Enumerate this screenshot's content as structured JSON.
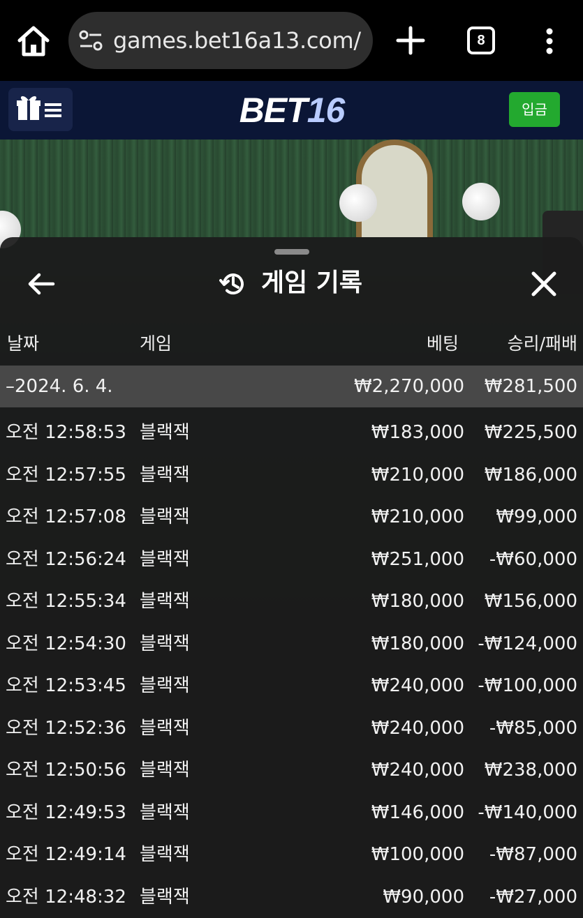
{
  "browser": {
    "url": "games.bet16a13.com/",
    "tab_count": "8"
  },
  "header": {
    "logo_part1": "BET",
    "logo_part2": "16",
    "deposit_label": "입금"
  },
  "panel": {
    "title": "게임 기록",
    "columns": {
      "date": "날짜",
      "game": "게임",
      "bet": "베팅",
      "result": "승리/패배"
    },
    "summary": {
      "date": "–2024. 6. 4.",
      "bet": "₩2,270,000",
      "result": "₩281,500"
    },
    "rows": [
      {
        "time": "오전 12:58:53",
        "game": "블랙잭",
        "bet": "₩183,000",
        "result": "₩225,500"
      },
      {
        "time": "오전 12:57:55",
        "game": "블랙잭",
        "bet": "₩210,000",
        "result": "₩186,000"
      },
      {
        "time": "오전 12:57:08",
        "game": "블랙잭",
        "bet": "₩210,000",
        "result": "₩99,000"
      },
      {
        "time": "오전 12:56:24",
        "game": "블랙잭",
        "bet": "₩251,000",
        "result": "-₩60,000"
      },
      {
        "time": "오전 12:55:34",
        "game": "블랙잭",
        "bet": "₩180,000",
        "result": "₩156,000"
      },
      {
        "time": "오전 12:54:30",
        "game": "블랙잭",
        "bet": "₩180,000",
        "result": "-₩124,000"
      },
      {
        "time": "오전 12:53:45",
        "game": "블랙잭",
        "bet": "₩240,000",
        "result": "-₩100,000"
      },
      {
        "time": "오전 12:52:36",
        "game": "블랙잭",
        "bet": "₩240,000",
        "result": "-₩85,000"
      },
      {
        "time": "오전 12:50:56",
        "game": "블랙잭",
        "bet": "₩240,000",
        "result": "₩238,000"
      },
      {
        "time": "오전 12:49:53",
        "game": "블랙잭",
        "bet": "₩146,000",
        "result": "-₩140,000"
      },
      {
        "time": "오전 12:49:14",
        "game": "블랙잭",
        "bet": "₩100,000",
        "result": "-₩87,000"
      },
      {
        "time": "오전 12:48:32",
        "game": "블랙잭",
        "bet": "₩90,000",
        "result": "-₩27,000"
      }
    ]
  },
  "icons": {
    "home": "home-icon",
    "site_settings": "tune-icon",
    "new_tab": "plus-icon",
    "more": "more-vertical-icon",
    "menu": "gift-menu-icon",
    "back": "arrow-left-icon",
    "history": "history-icon",
    "close": "close-icon"
  },
  "colors": {
    "header_bg": "#0b1636",
    "deposit_green": "#23a92f",
    "logo_accent": "#b9ccff",
    "panel_bg": "#1c1c1c",
    "summary_bg": "#484848"
  }
}
